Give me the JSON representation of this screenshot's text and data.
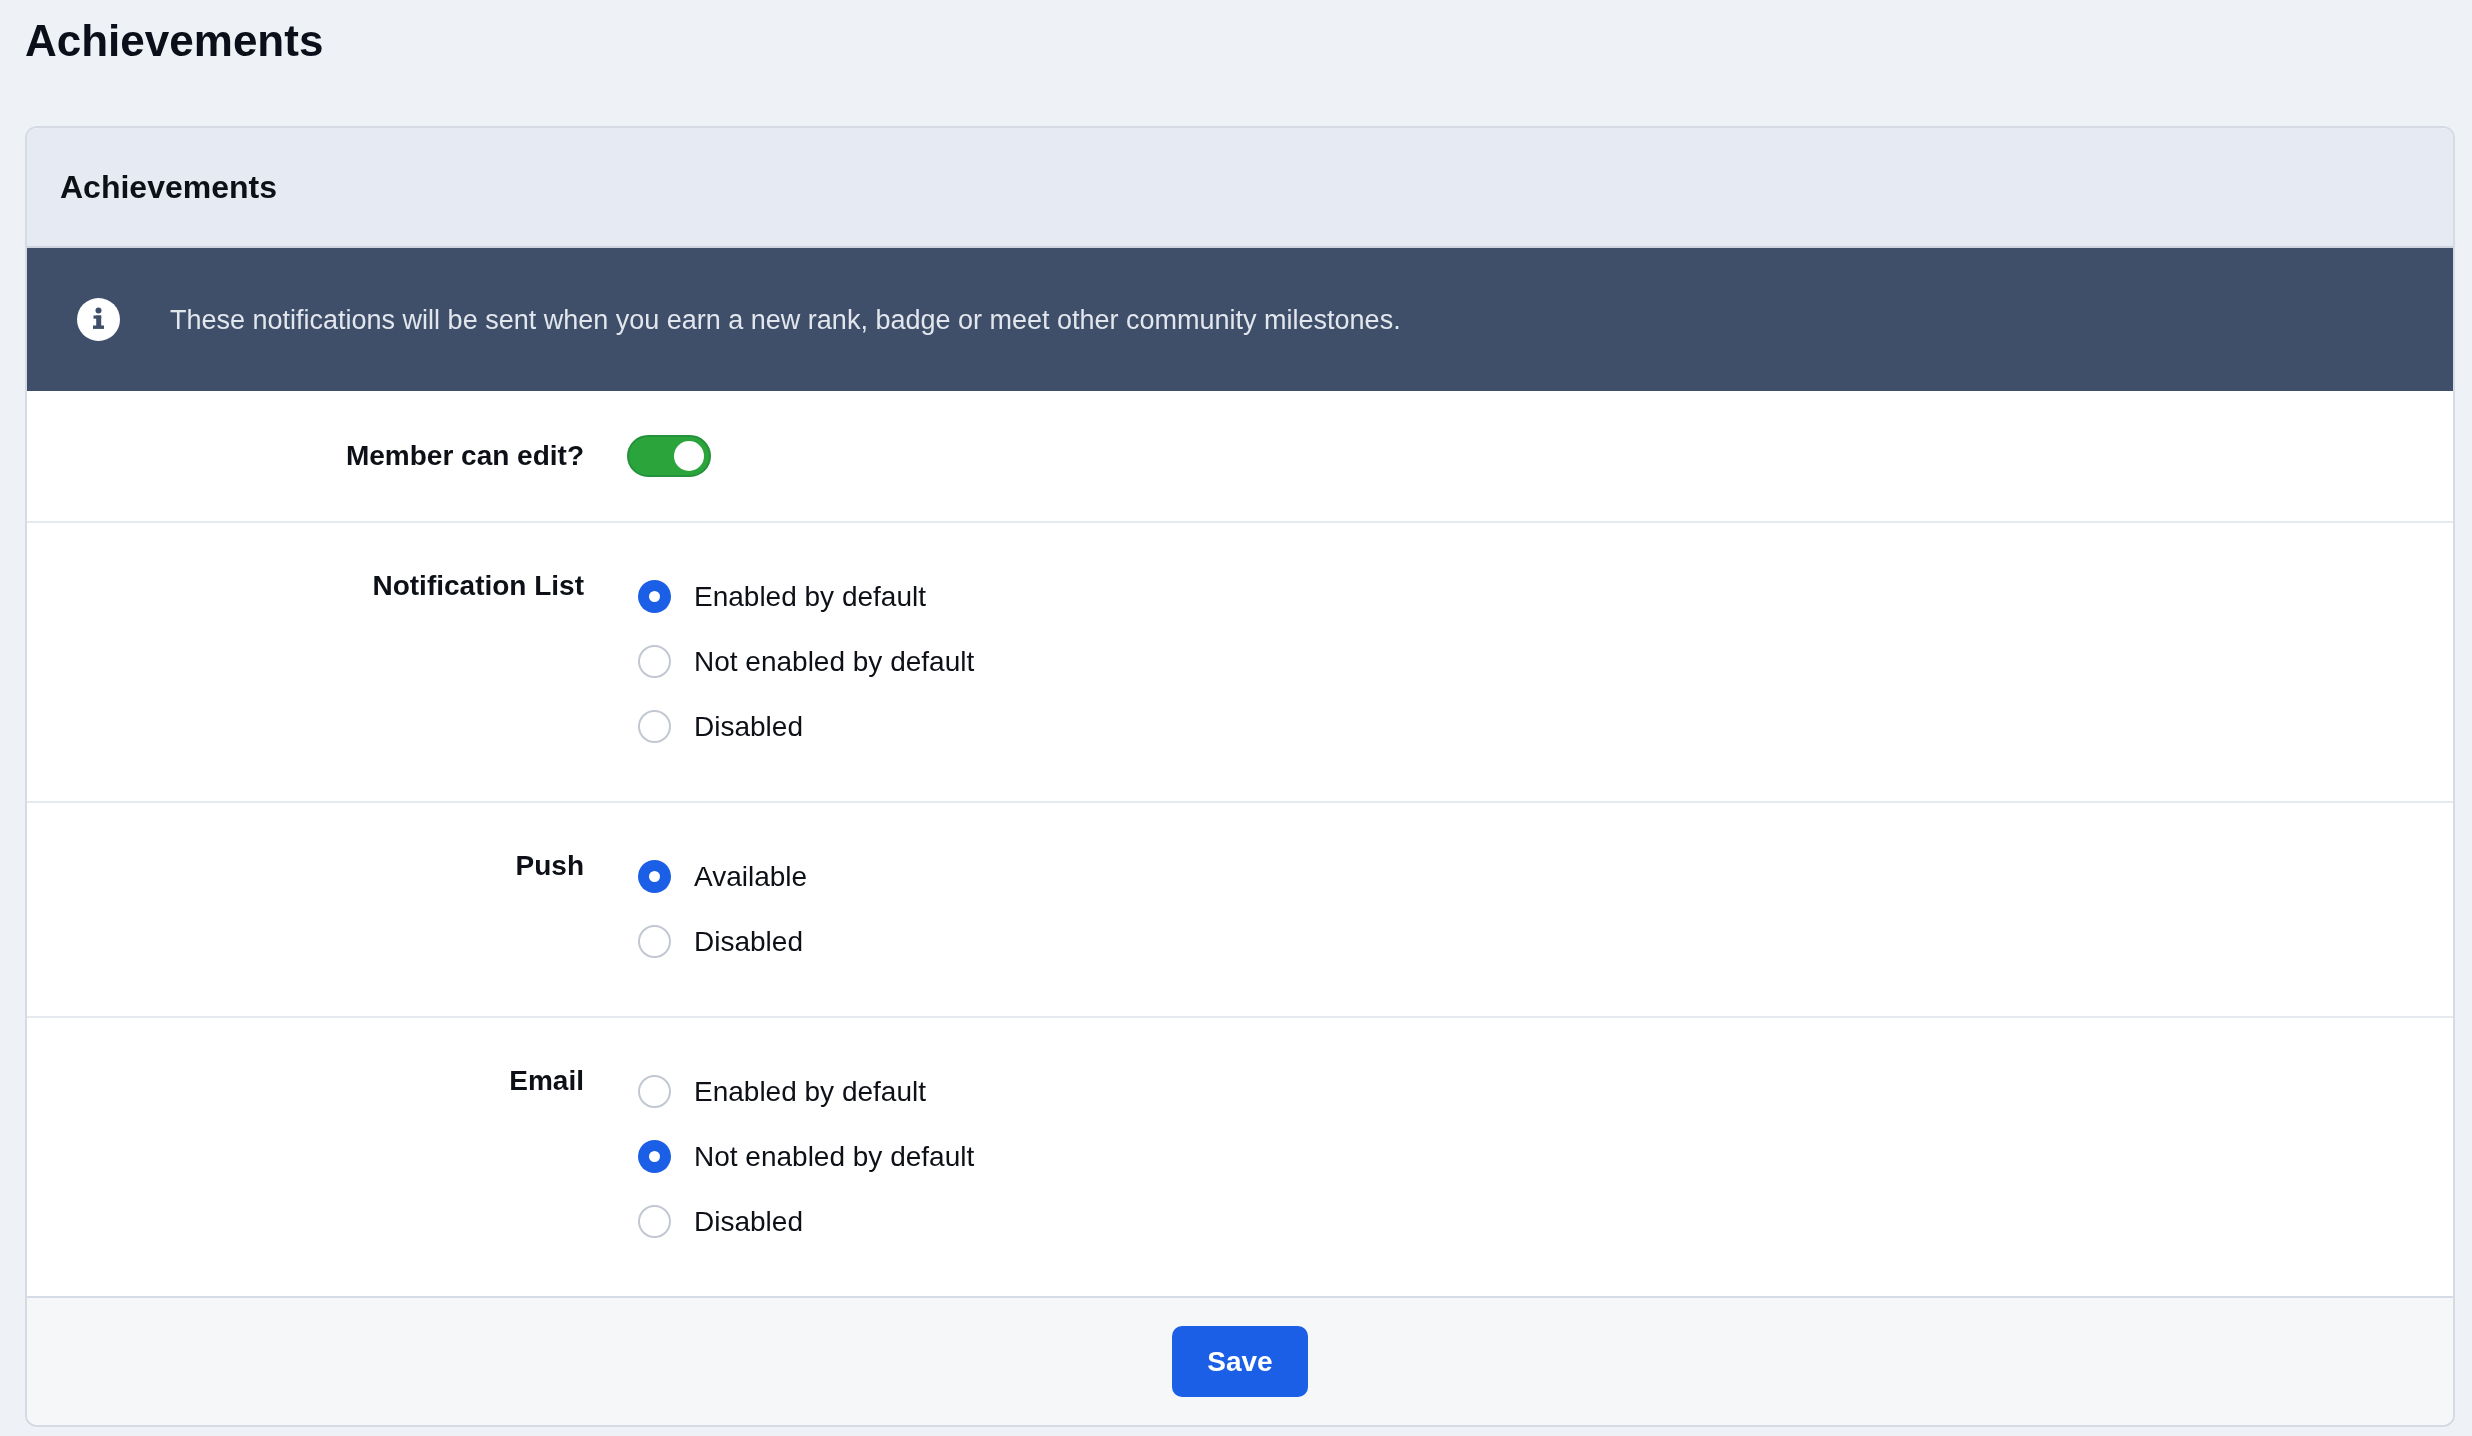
{
  "page": {
    "title": "Achievements"
  },
  "card": {
    "title": "Achievements",
    "info_banner": {
      "text": "These notifications will be sent when you earn a new rank, badge or meet other community milestones."
    },
    "settings": [
      {
        "kind": "toggle",
        "label": "Member can edit?",
        "on": true
      },
      {
        "kind": "radio_group",
        "label": "Notification List",
        "options": [
          {
            "label": "Enabled by default",
            "selected": true
          },
          {
            "label": "Not enabled by default",
            "selected": false
          },
          {
            "label": "Disabled",
            "selected": false
          }
        ]
      },
      {
        "kind": "radio_group",
        "label": "Push",
        "options": [
          {
            "label": "Available",
            "selected": true
          },
          {
            "label": "Disabled",
            "selected": false
          }
        ]
      },
      {
        "kind": "radio_group",
        "label": "Email",
        "options": [
          {
            "label": "Enabled by default",
            "selected": false
          },
          {
            "label": "Not enabled by default",
            "selected": true
          },
          {
            "label": "Disabled",
            "selected": false
          }
        ]
      }
    ],
    "footer": {
      "buttons": [
        {
          "label": "Save"
        }
      ]
    }
  }
}
